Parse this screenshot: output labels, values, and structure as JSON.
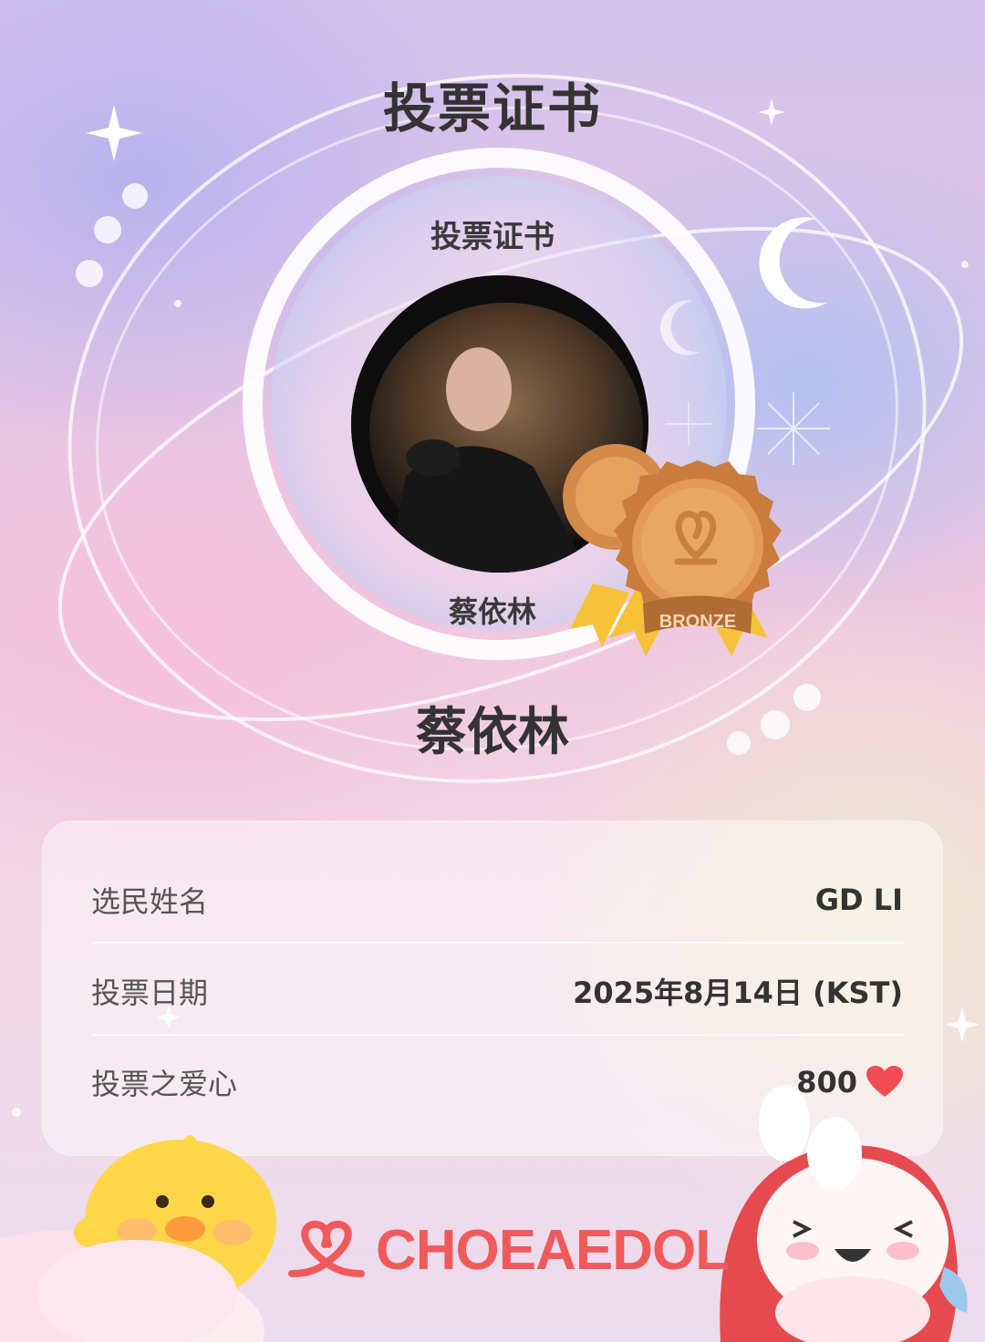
{
  "certificate": {
    "title": "投票证书",
    "badge_title": "投票证书",
    "idol_name_badge": "蔡依林",
    "idol_name": "蔡依林",
    "medal_label": "BRONZE"
  },
  "details": [
    {
      "label": "选民姓名",
      "value": "GD LI"
    },
    {
      "label": "投票日期",
      "value": "2025年8月14日 (KST)"
    },
    {
      "label": "投票之爱心",
      "value": "800"
    }
  ],
  "brand": {
    "name": "CHOEAEDOL",
    "color": "#f05a5a"
  },
  "icons": [
    "heart-icon",
    "bronze-medal-icon",
    "choeaedol-logo-icon",
    "moon-icon",
    "sparkle-icon"
  ],
  "colors": {
    "bronze": "#e5a25f",
    "ribbon": "#f5c23a",
    "heart": "#ef4d52"
  }
}
